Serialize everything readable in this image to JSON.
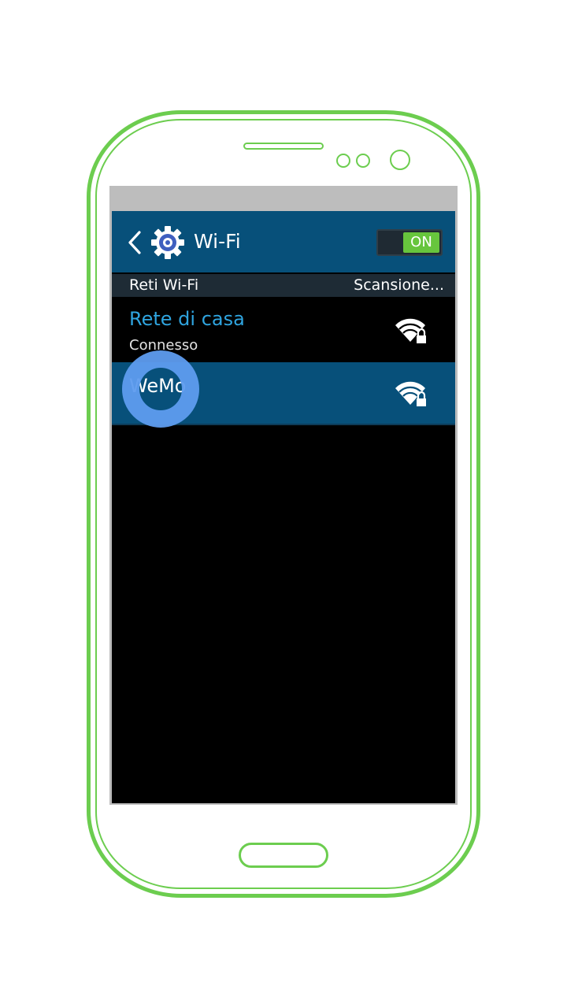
{
  "action_bar": {
    "back_icon": "chevron-left-icon",
    "settings_icon": "gear-icon",
    "title": "Wi-Fi",
    "toggle_label": "ON",
    "toggle_state": "on",
    "toggle_color": "#67c53d"
  },
  "section_header": {
    "title": "Reti Wi-Fi",
    "action": "Scansione..."
  },
  "networks": [
    {
      "name": "Rete di casa",
      "status": "Connesso",
      "icon": "wifi-secured-icon",
      "selected": false,
      "name_color": "#2fa4df"
    },
    {
      "name": "WeMo",
      "status": "",
      "icon": "wifi-secured-icon",
      "selected": true,
      "name_color": "#ffffff"
    }
  ],
  "colors": {
    "phone_outline": "#6ccd4f",
    "action_bar": "#07507a",
    "selected_row": "#07507a",
    "touch_indicator": "#5e9cef"
  }
}
